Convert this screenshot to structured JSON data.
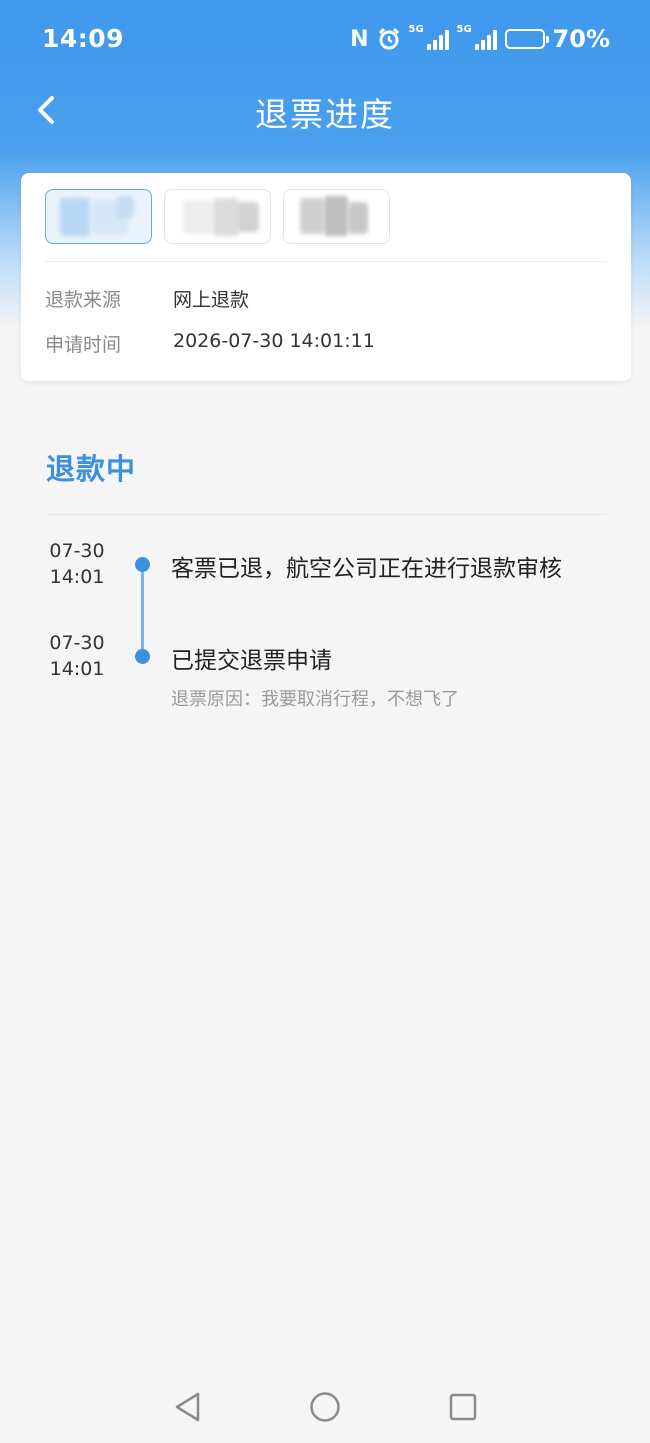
{
  "status_bar": {
    "time": "14:09",
    "nfc_label": "N",
    "network_1": "5G",
    "network_2": "5G",
    "battery_percent": "70%",
    "battery_level": 0.7,
    "battery_color": "#f7c842"
  },
  "header": {
    "title": "退票进度",
    "back_icon": "chevron-left-icon"
  },
  "info_card": {
    "passengers": [
      {
        "selected": true
      },
      {
        "selected": false
      },
      {
        "selected": false
      }
    ],
    "refund_source_label": "退款来源",
    "refund_source_value": "网上退款",
    "apply_time_label": "申请时间",
    "apply_time_value": "2026-07-30 14:01:11"
  },
  "progress": {
    "status": "退款中",
    "events": [
      {
        "date": "07-30",
        "time": "14:01",
        "text": "客票已退，航空公司正在进行退款审核",
        "sub": ""
      },
      {
        "date": "07-30",
        "time": "14:01",
        "text": "已提交退票申请",
        "sub": "退票原因：我要取消行程，不想飞了"
      }
    ]
  },
  "system_nav": {
    "back_icon": "triangle-back-icon",
    "home_icon": "circle-home-icon",
    "recents_icon": "square-recents-icon"
  },
  "colors": {
    "primary": "#3d8fe0",
    "header_blue": "#3f98ec",
    "timeline_line": "#79b3ee"
  }
}
